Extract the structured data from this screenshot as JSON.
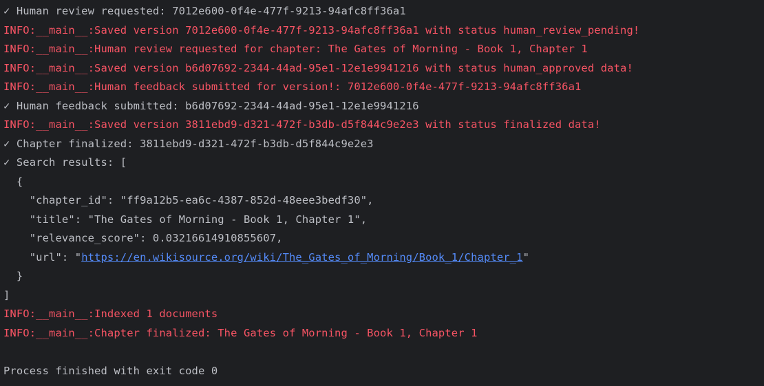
{
  "colors": {
    "background": "#1e1f22",
    "stdout": "#bcbec4",
    "log_info": "#f75464",
    "link": "#548af7"
  },
  "console": {
    "lines": [
      {
        "kind": "plain",
        "text": "✓ Human review requested: 7012e600-0f4e-477f-9213-94afc8ff36a1"
      },
      {
        "kind": "info",
        "text": "INFO:__main__:Saved version 7012e600-0f4e-477f-9213-94afc8ff36a1 with status human_review_pending!"
      },
      {
        "kind": "info",
        "text": "INFO:__main__:Human review requested for chapter: The Gates of Morning - Book 1, Chapter 1"
      },
      {
        "kind": "info",
        "text": "INFO:__main__:Saved version b6d07692-2344-44ad-95e1-12e1e9941216 with status human_approved data!"
      },
      {
        "kind": "info",
        "text": "INFO:__main__:Human feedback submitted for version!: 7012e600-0f4e-477f-9213-94afc8ff36a1"
      },
      {
        "kind": "plain",
        "text": "✓ Human feedback submitted: b6d07692-2344-44ad-95e1-12e1e9941216"
      },
      {
        "kind": "info",
        "text": "INFO:__main__:Saved version 3811ebd9-d321-472f-b3db-d5f844c9e2e3 with status finalized data!"
      },
      {
        "kind": "plain",
        "text": "✓ Chapter finalized: 3811ebd9-d321-472f-b3db-d5f844c9e2e3"
      },
      {
        "kind": "plain",
        "text": "✓ Search results: ["
      },
      {
        "kind": "plain",
        "text": "  {"
      },
      {
        "kind": "plain",
        "text": "    \"chapter_id\": \"ff9a12b5-ea6c-4387-852d-48eee3bedf30\","
      },
      {
        "kind": "plain",
        "text": "    \"title\": \"The Gates of Morning - Book 1, Chapter 1\","
      },
      {
        "kind": "plain",
        "text": "    \"relevance_score\": 0.03216614910855607,"
      },
      {
        "kind": "url",
        "prefix": "    \"url\": \"",
        "link": "https://en.wikisource.org/wiki/The_Gates_of_Morning/Book_1/Chapter_1",
        "suffix": "\""
      },
      {
        "kind": "plain",
        "text": "  }"
      },
      {
        "kind": "plain",
        "text": "]"
      },
      {
        "kind": "info",
        "text": "INFO:__main__:Indexed 1 documents"
      },
      {
        "kind": "info",
        "text": "INFO:__main__:Chapter finalized: The Gates of Morning - Book 1, Chapter 1"
      },
      {
        "kind": "plain",
        "text": ""
      },
      {
        "kind": "plain",
        "text": "Process finished with exit code 0"
      }
    ]
  }
}
